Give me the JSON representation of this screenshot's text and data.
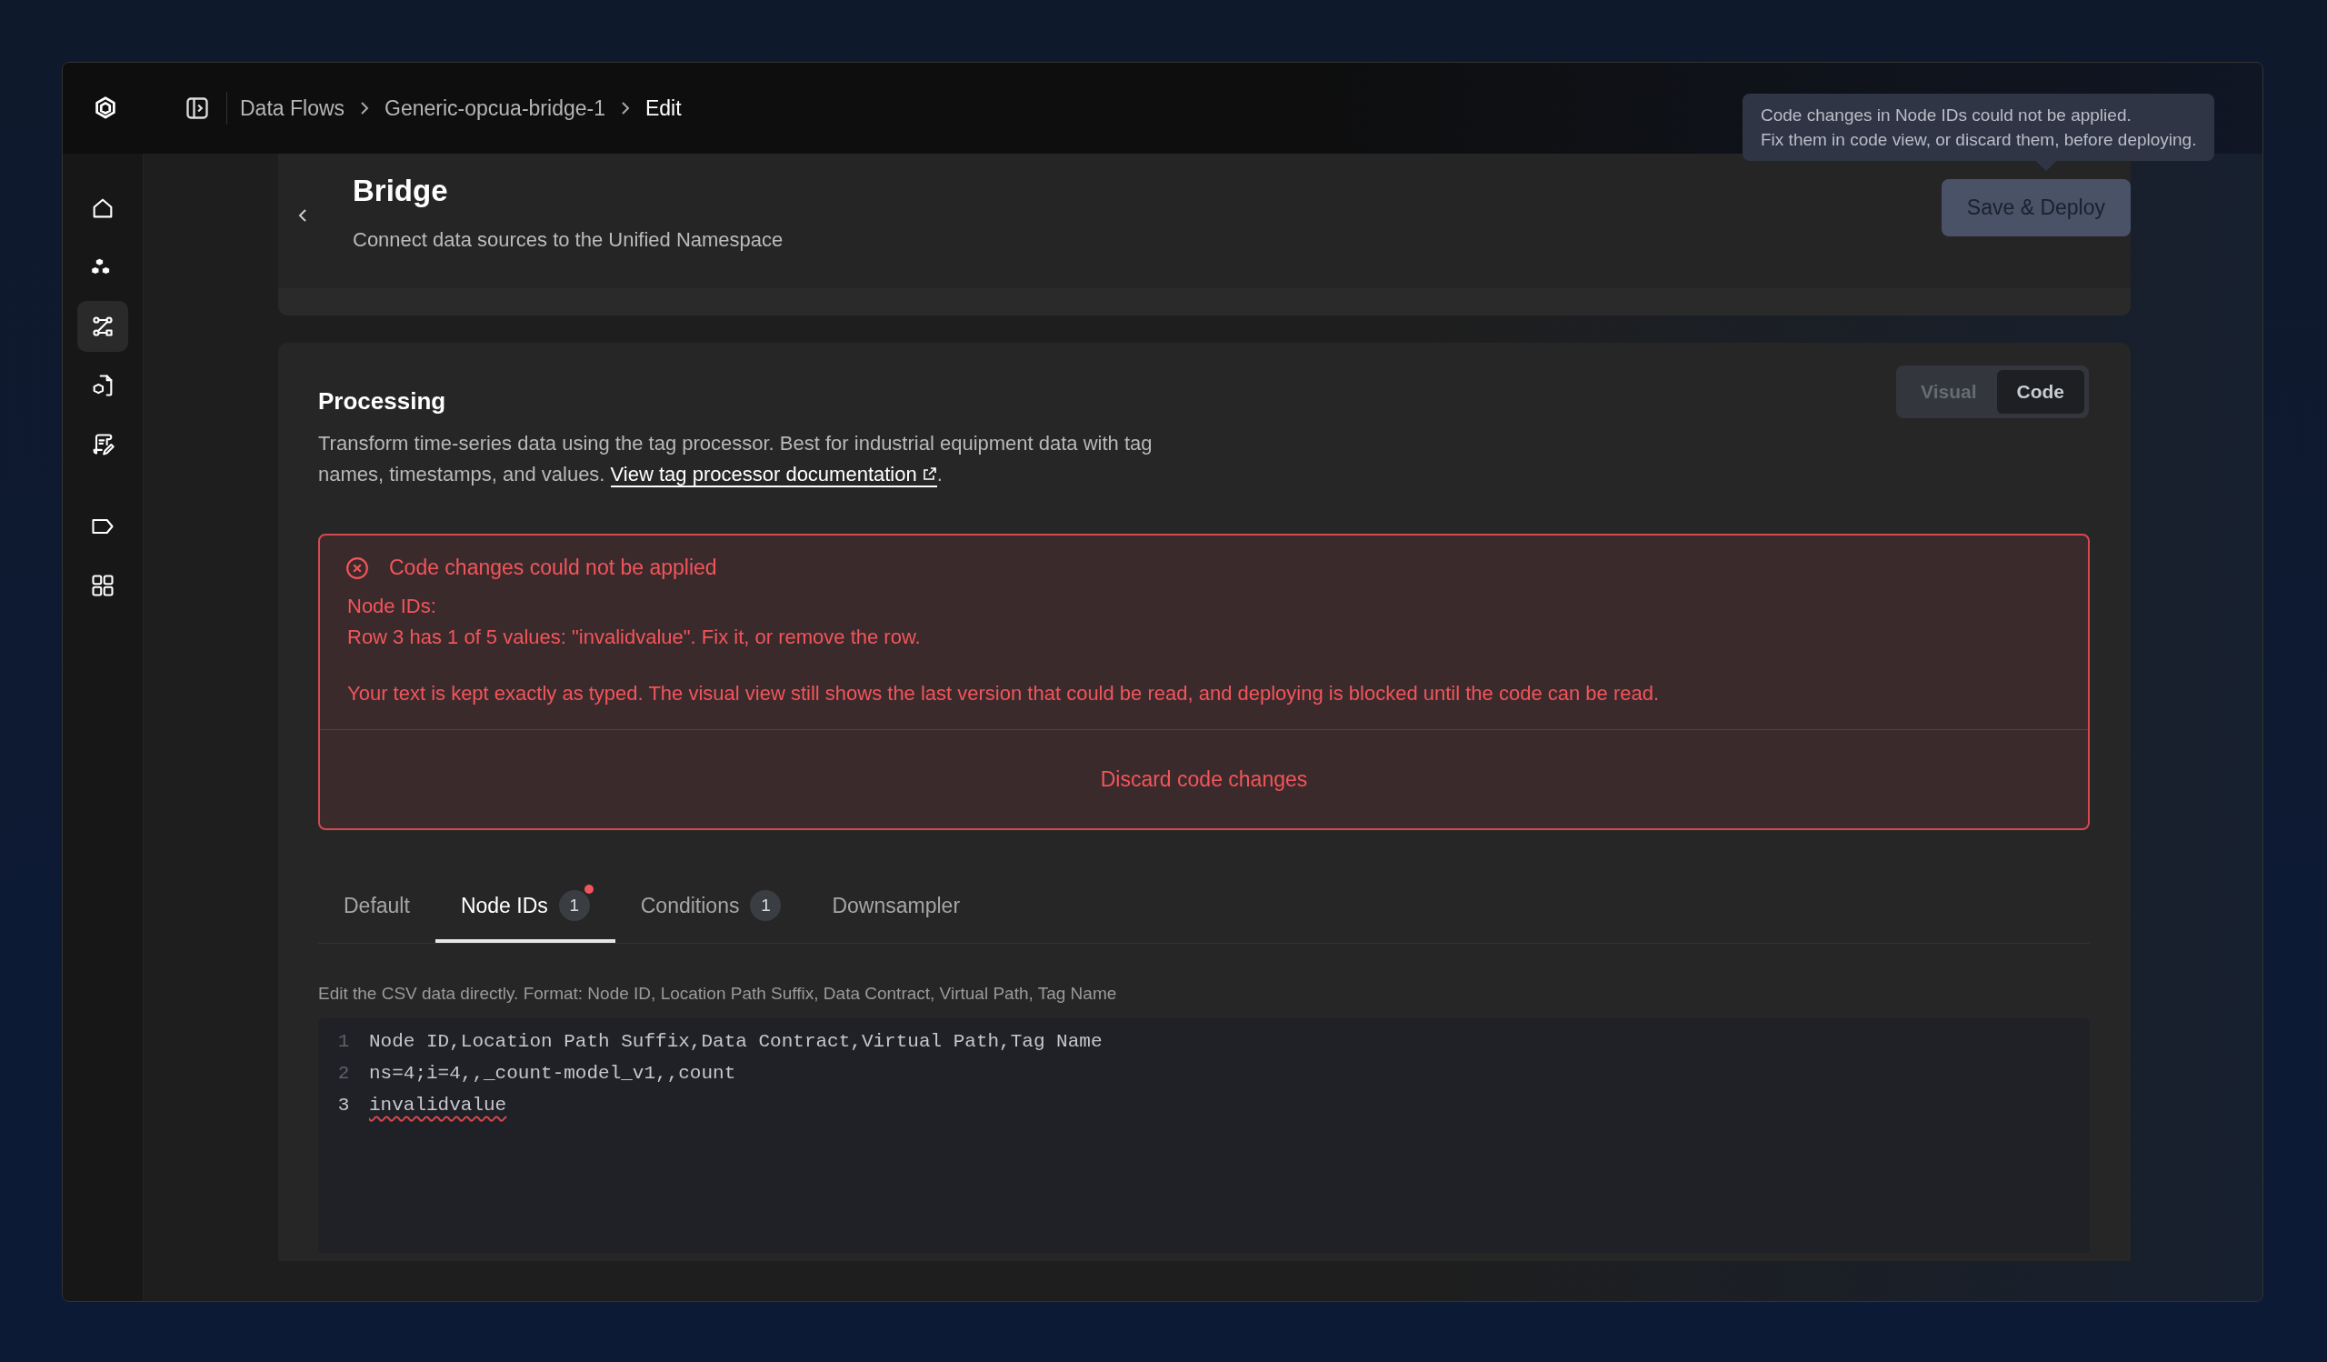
{
  "topbar": {
    "breadcrumbs": [
      {
        "label": "Data Flows",
        "current": false
      },
      {
        "label": "Generic-opcua-bridge-1",
        "current": false
      },
      {
        "label": "Edit",
        "current": true
      }
    ]
  },
  "sidebar": {
    "groups": [
      [
        {
          "kind": "home",
          "selected": false
        },
        {
          "kind": "cubes",
          "selected": false
        },
        {
          "kind": "flow",
          "selected": true
        },
        {
          "kind": "file-cube",
          "selected": false
        },
        {
          "kind": "script-edit",
          "selected": false
        }
      ],
      [
        {
          "kind": "tag",
          "selected": false
        },
        {
          "kind": "grid",
          "selected": false
        }
      ]
    ]
  },
  "header": {
    "title": "Bridge",
    "subtitle": "Connect data sources to the Unified Namespace",
    "save_button": {
      "label": "Save & Deploy",
      "disabled": true
    }
  },
  "tooltip": {
    "lines": [
      "Code changes in Node IDs could not be applied.",
      "Fix them in code view, or discard them, before deploying."
    ]
  },
  "processing": {
    "title": "Processing",
    "description": "Transform time-series data using the tag processor. Best for industrial equipment data with tag names, timestamps, and values.",
    "link": "View tag processor documentation",
    "after_link": ".",
    "view_toggle": [
      {
        "label": "Visual",
        "selected": false
      },
      {
        "label": "Code",
        "selected": true
      }
    ],
    "error": {
      "title": "Code changes could not be applied",
      "lines": [
        "Node IDs:",
        "Row 3 has 1 of 5 values: \"invalidvalue\". Fix it, or remove the row."
      ],
      "note": "Your text is kept exactly as typed. The visual view still shows the last version that could be read, and deploying is blocked until the code can be read.",
      "action": "Discard code changes"
    },
    "tabs": [
      {
        "label": "Default",
        "selected": false
      },
      {
        "label": "Node IDs",
        "selected": true,
        "count": "1",
        "alert": true
      },
      {
        "label": "Conditions",
        "selected": false,
        "count": "1",
        "alert": false
      },
      {
        "label": "Downsampler",
        "selected": false
      }
    ],
    "editor": {
      "hint": "Edit the CSV data directly. Format: Node ID, Location Path Suffix, Data Contract, Virtual Path, Tag Name",
      "lines": [
        {
          "number": "1",
          "text": "Node ID,Location Path Suffix,Data Contract,Virtual Path,Tag Name",
          "error": false,
          "current": false
        },
        {
          "number": "2",
          "text": "ns=4;i=4,,_count-model_v1,,count",
          "error": false,
          "current": false
        },
        {
          "number": "3",
          "text": "invalidvalue",
          "error": true,
          "current": true
        }
      ]
    }
  }
}
